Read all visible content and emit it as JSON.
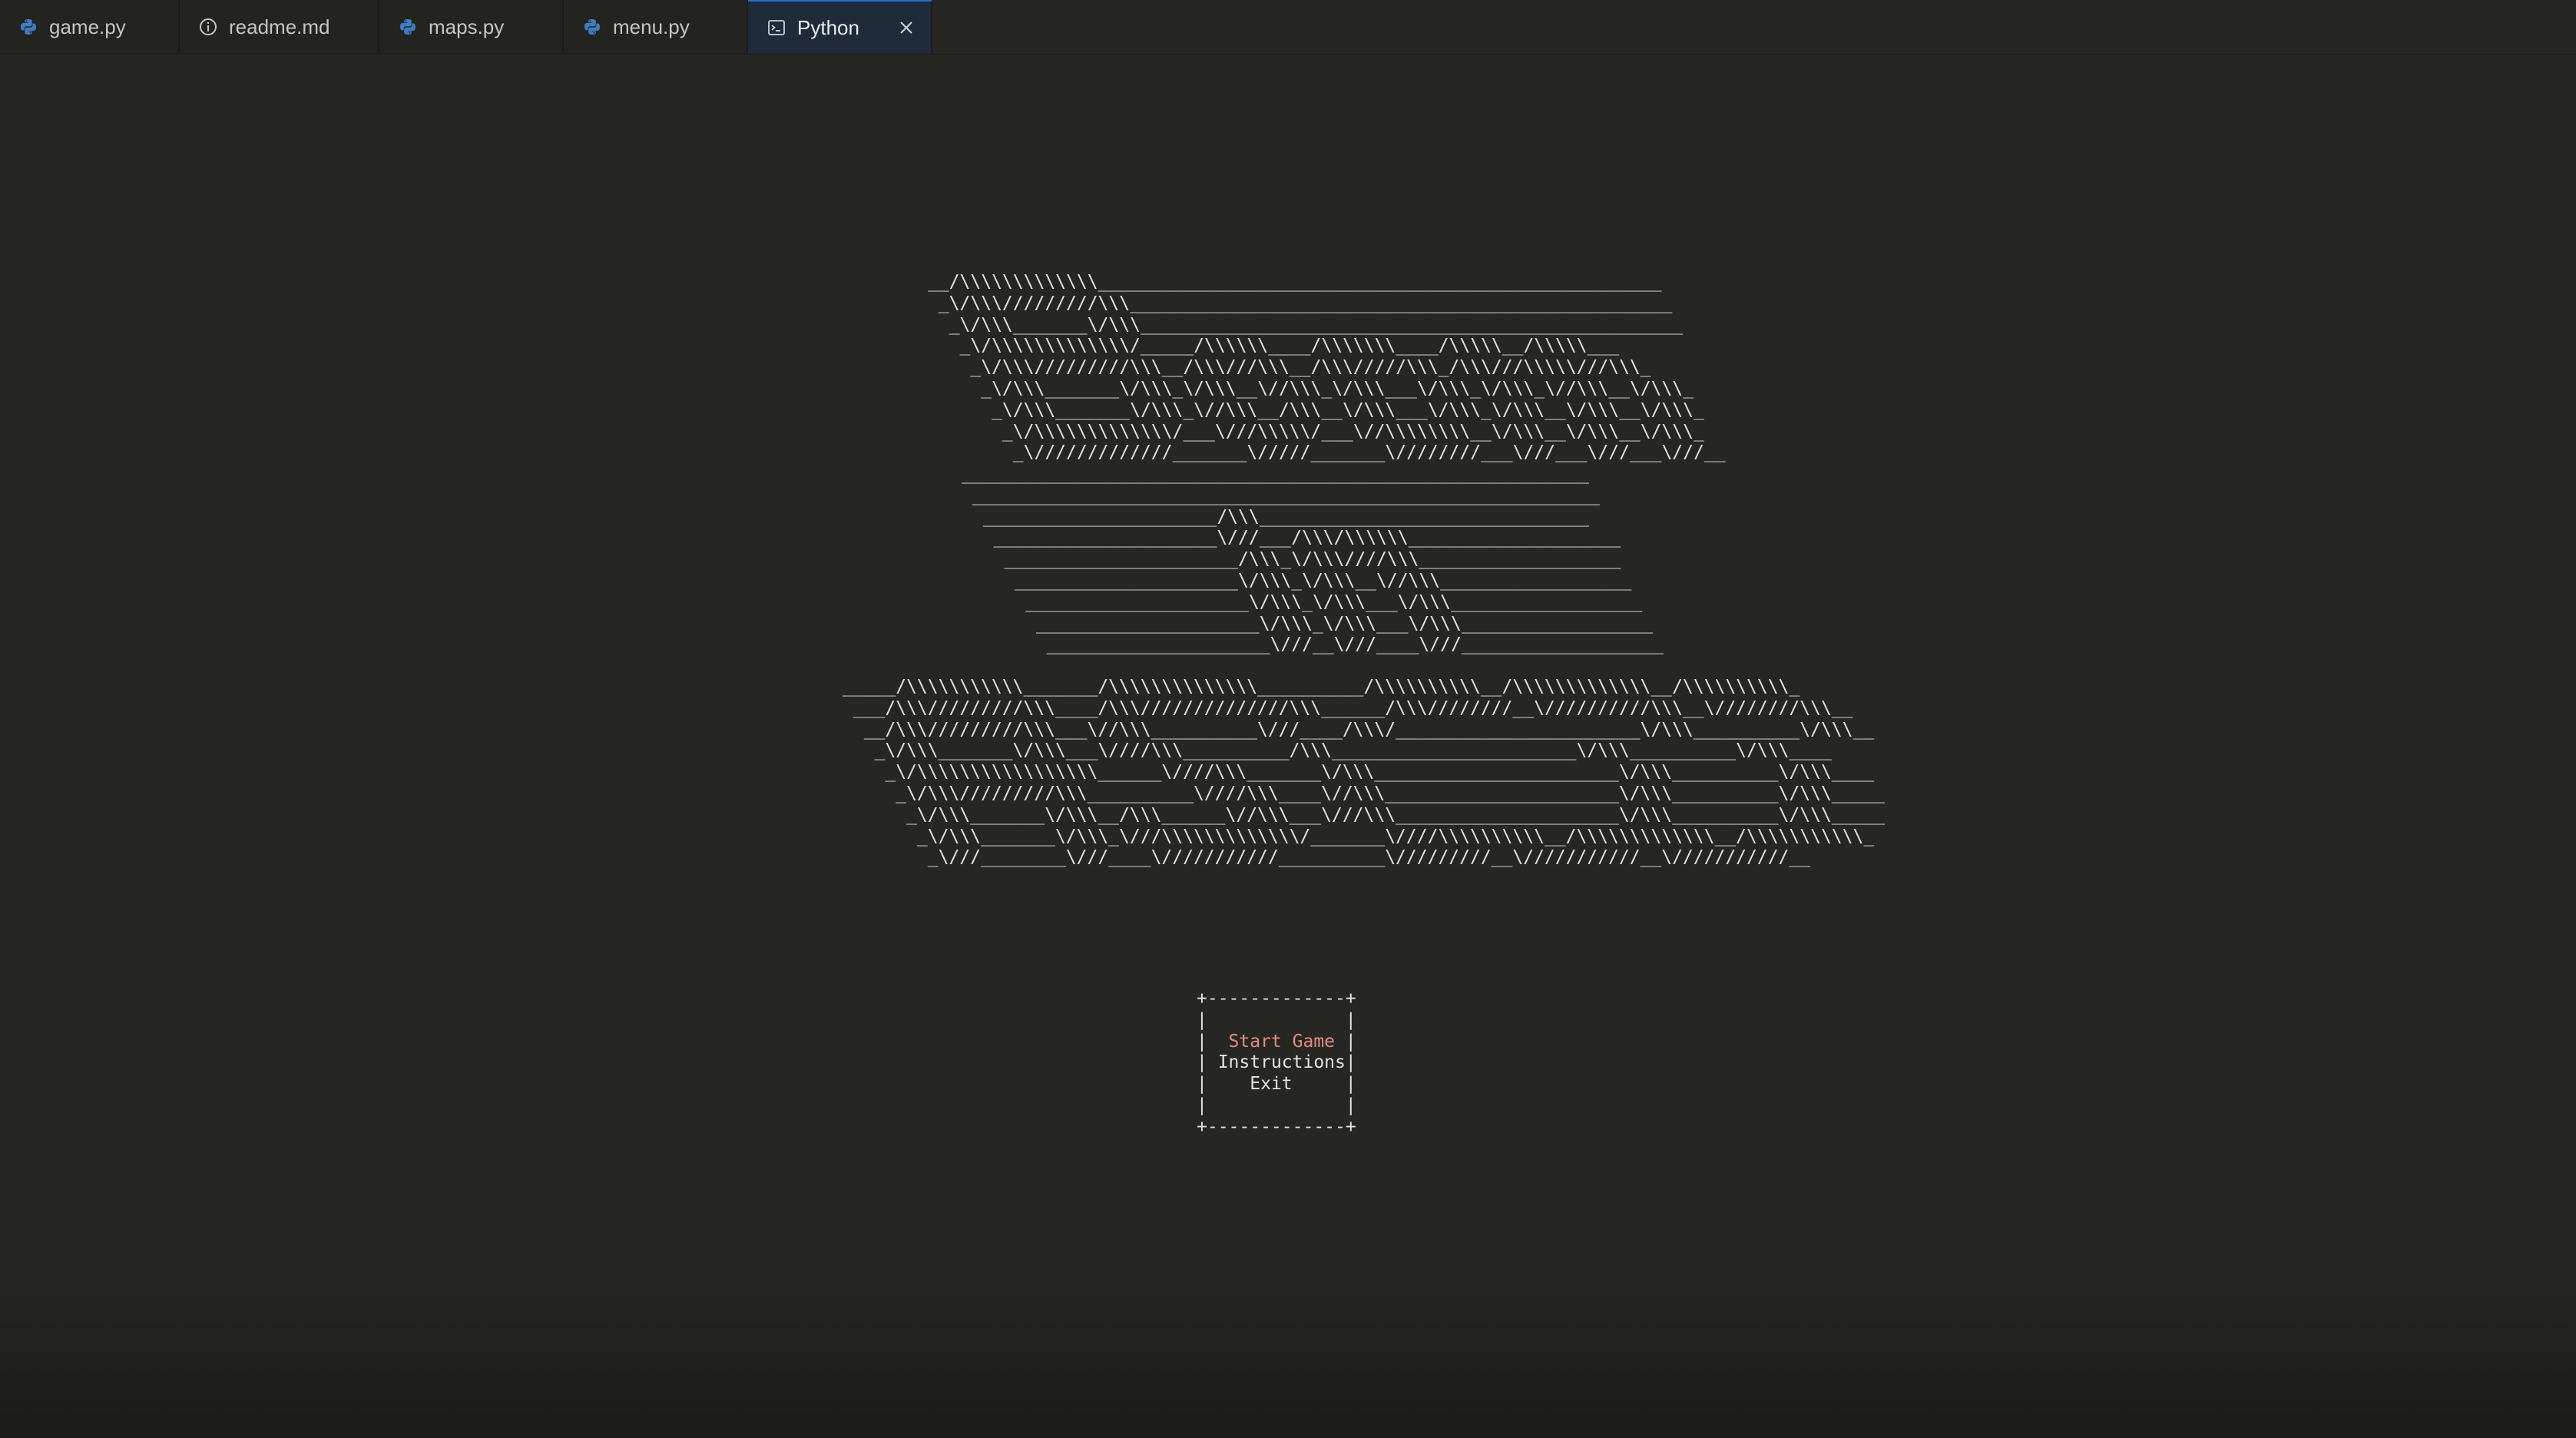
{
  "tabs": [
    {
      "label": "game.py",
      "icon": "python-icon",
      "active": false
    },
    {
      "label": "readme.md",
      "icon": "info-icon",
      "active": false
    },
    {
      "label": "maps.py",
      "icon": "python-icon",
      "active": false
    },
    {
      "label": "menu.py",
      "icon": "python-icon",
      "active": false
    },
    {
      "label": "Python",
      "icon": "terminal-icon",
      "active": true,
      "closable": true
    }
  ],
  "colors": {
    "background": "#262723",
    "active_tab": "#1f2b3a",
    "active_tab_border": "#2a6fd6",
    "text": "#e2e2de",
    "selected_menu_item": "#e58a81"
  },
  "banner": {
    "block1": [
      "__/\\\\\\\\\\\\\\\\\\\\\\\\\\_____________________________________________________",
      " _\\/\\\\\\/////////\\\\\\___________________________________________________",
      "  _\\/\\\\\\_______\\/\\\\\\___________________________________________________",
      "   _\\/\\\\\\\\\\\\\\\\\\\\\\\\\\/_____/\\\\\\\\\\\\____/\\\\\\\\\\\\\\____/\\\\\\\\\\__/\\\\\\\\\\___",
      "    _\\/\\\\\\/////////\\\\\\__/\\\\\\///\\\\\\__/\\\\\\/////\\\\\\_/\\\\\\///\\\\\\\\\\///\\\\\\_",
      "     _\\/\\\\\\_______\\/\\\\\\_\\/\\\\\\__\\//\\\\\\_\\/\\\\\\___\\/\\\\\\_\\/\\\\\\_\\//\\\\\\__\\/\\\\\\_",
      "      _\\/\\\\\\_______\\/\\\\\\_\\//\\\\\\__/\\\\\\__\\/\\\\\\___\\/\\\\\\_\\/\\\\\\__\\/\\\\\\__\\/\\\\\\_",
      "       _\\/\\\\\\\\\\\\\\\\\\\\\\\\\\/___\\///\\\\\\\\\\/___\\//\\\\\\\\\\\\\\\\__\\/\\\\\\__\\/\\\\\\__\\/\\\\\\_",
      "        _\\/////////////_______\\/////_______\\////////___\\///___\\///___\\///__"
    ],
    "block2": [
      "___________________________________________________________",
      " ___________________________________________________________",
      "  ______________________/\\\\\\_______________________________",
      "   _____________________\\///___/\\\\\\/\\\\\\\\\\\\____________________",
      "    ______________________/\\\\\\_\\/\\\\\\////\\\\\\___________________",
      "     _____________________\\/\\\\\\_\\/\\\\\\__\\//\\\\\\__________________",
      "      _____________________\\/\\\\\\_\\/\\\\\\___\\/\\\\\\__________________",
      "       _____________________\\/\\\\\\_\\/\\\\\\___\\/\\\\\\__________________",
      "        _____________________\\///__\\///____\\///___________________"
    ],
    "block3": [
      "_____/\\\\\\\\\\\\\\\\\\\\\\_______/\\\\\\\\\\\\\\\\\\\\\\\\\\\\__________/\\\\\\\\\\\\\\\\\\\\__/\\\\\\\\\\\\\\\\\\\\\\\\\\__/\\\\\\\\\\\\\\\\\\\\_",
      " ___/\\\\\\/////////\\\\\\____/\\\\\\//////////////\\\\\\______/\\\\\\////////__\\//////////\\\\\\__\\////////\\\\\\__",
      "  __/\\\\\\/////////\\\\\\___\\//\\\\\\__________\\///____/\\\\\\/_______________________\\/\\\\\\__________\\/\\\\\\__",
      "   _\\/\\\\\\_______\\/\\\\\\___\\////\\\\\\__________/\\\\\\_______________________\\/\\\\\\__________\\/\\\\\\____",
      "    _\\/\\\\\\\\\\\\\\\\\\\\\\\\\\\\\\\\\\______\\////\\\\\\_______\\/\\\\\\_______________________\\/\\\\\\__________\\/\\\\\\____",
      "     _\\/\\\\\\/////////\\\\\\__________\\////\\\\\\____\\//\\\\\\______________________\\/\\\\\\__________\\/\\\\\\_____",
      "      _\\/\\\\\\_______\\/\\\\\\__/\\\\\\______\\//\\\\\\___\\///\\\\\\_____________________\\/\\\\\\__________\\/\\\\\\_____",
      "       _\\/\\\\\\_______\\/\\\\\\_\\///\\\\\\\\\\\\\\\\\\\\\\\\\\/_______\\////\\\\\\\\\\\\\\\\\\\\__/\\\\\\\\\\\\\\\\\\\\\\\\\\__/\\\\\\\\\\\\\\\\\\\\\\_",
      "        _\\///________\\///____\\///////////__________\\/////////__\\///////////__\\///////////__"
    ]
  },
  "menu": {
    "border_top": "+-------------+",
    "border_bottom": "+-------------+",
    "items": [
      {
        "label": "Start Game",
        "selected": true
      },
      {
        "label": "Instructions",
        "selected": false
      },
      {
        "label": "Exit",
        "selected": false
      }
    ]
  }
}
